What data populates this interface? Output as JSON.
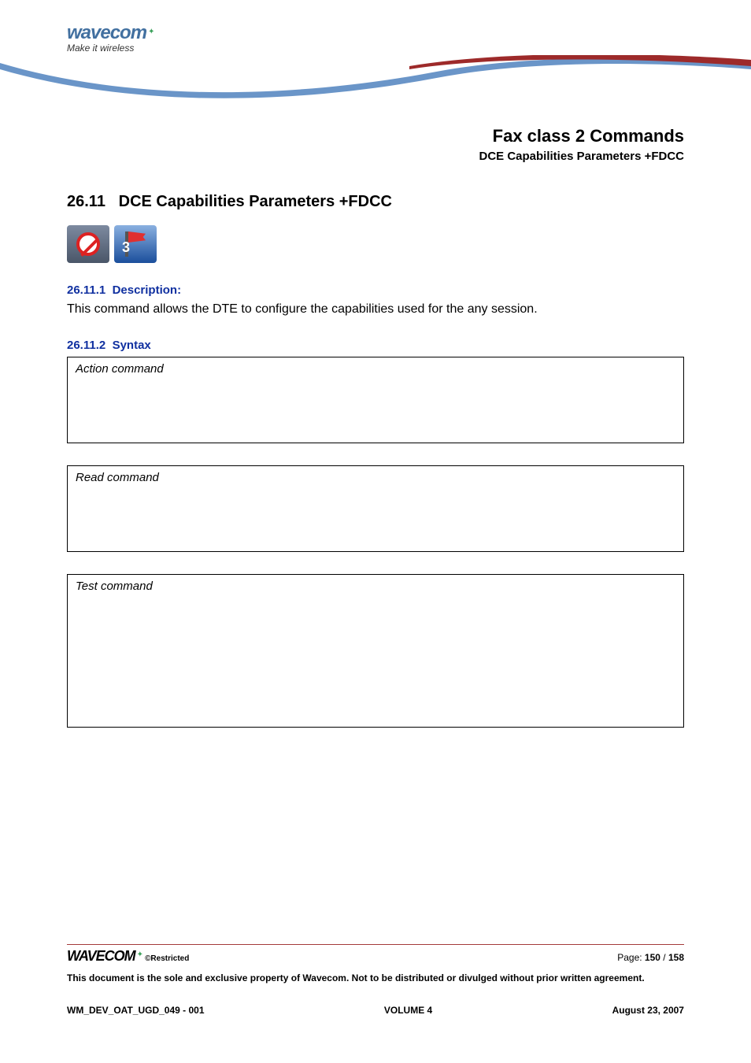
{
  "logo": {
    "brand": "wavecom",
    "tagline": "Make it wireless"
  },
  "chapter": {
    "title": "Fax class 2 Commands",
    "subtitle": "DCE Capabilities Parameters +FDCC"
  },
  "section": {
    "number": "26.11",
    "title": "DCE Capabilities Parameters +FDCC",
    "icon_flag_num": "3"
  },
  "description": {
    "heading_num": "26.11.1",
    "heading_text": "Description:",
    "body": "This command allows the DTE to configure the capabilities used for the any session."
  },
  "syntax": {
    "heading_num": "26.11.2",
    "heading_text": "Syntax",
    "boxes": [
      {
        "label": "Action command"
      },
      {
        "label": "Read command"
      },
      {
        "label": "Test command"
      }
    ]
  },
  "footer": {
    "brand": "WAVECOM",
    "restricted": "©Restricted",
    "page_label": "Page: ",
    "page_current": "150",
    "page_sep": " / ",
    "page_total": "158",
    "legal": "This document is the sole and exclusive property of Wavecom. Not to be distributed or divulged without prior written agreement.",
    "doc_id": "WM_DEV_OAT_UGD_049 - 001",
    "volume": "VOLUME 4",
    "date": "August 23, 2007"
  }
}
